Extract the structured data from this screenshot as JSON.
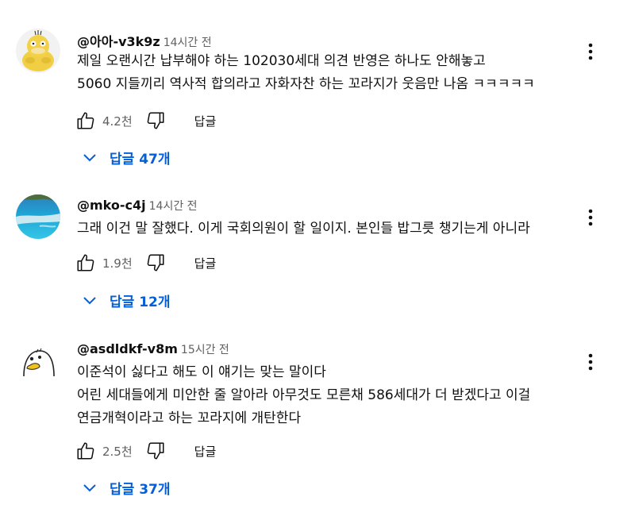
{
  "comments": [
    {
      "author": "@아아-v3k9z",
      "time": "14시간 전",
      "lines": [
        "제일 오랜시간 납부해야 하는 102030세대 의견 반영은 하나도 안해놓고",
        "5060 지들끼리 역사적 합의라고 자화자찬 하는 꼬라지가 웃음만 나옴 ㅋㅋㅋㅋㅋ"
      ],
      "likes": "4.2천",
      "reply_label": "답글",
      "replies_label": "답글 47개"
    },
    {
      "author": "@mko-c4j",
      "time": "14시간 전",
      "lines": [
        "그래 이건 말 잘했다. 이게 국회의원이 할 일이지. 본인들 밥그릇 챙기는게 아니라"
      ],
      "likes": "1.9천",
      "reply_label": "답글",
      "replies_label": "답글 12개"
    },
    {
      "author": "@asdldkf-v8m",
      "time": "15시간 전",
      "lines": [
        "이준석이 싫다고 해도 이 얘기는 맞는 말이다",
        "어린 세대들에게 미안한 줄 알아라 아무것도 모른채 586세대가 더 받겠다고 이걸",
        "연금개혁이라고 하는 꼬라지에 개탄한다"
      ],
      "likes": "2.5천",
      "reply_label": "답글",
      "replies_label": "답글 37개"
    }
  ],
  "colors": {
    "link": "#065fd4",
    "meta": "#606060",
    "text": "#0f0f0f"
  },
  "icons": [
    "avatar-psyduck",
    "avatar-ocean",
    "avatar-duck",
    "like-icon",
    "dislike-icon",
    "more-vert-icon",
    "chevron-down-icon"
  ]
}
